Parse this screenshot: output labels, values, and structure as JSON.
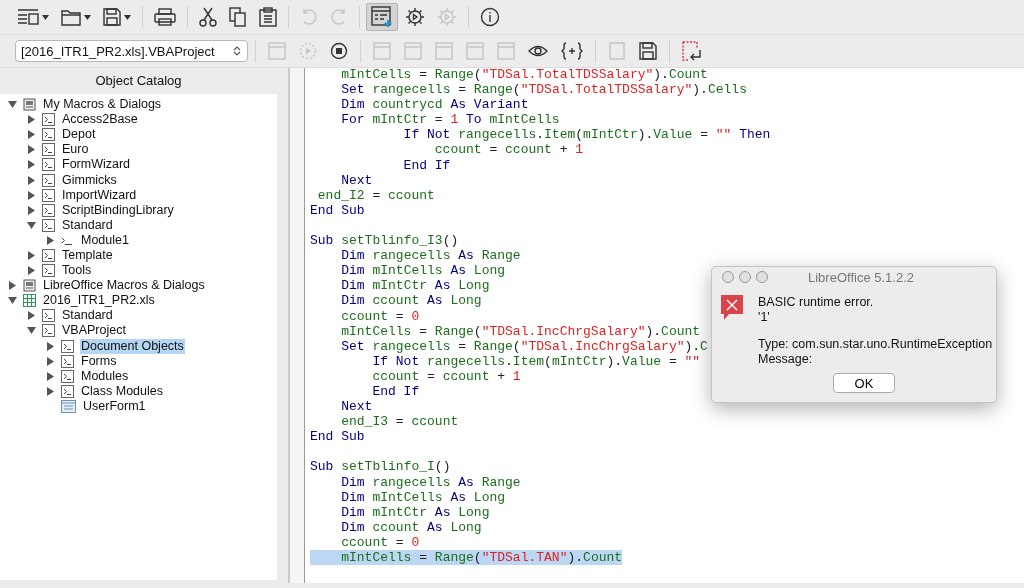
{
  "toolbar": [
    {
      "kind": "list",
      "dropdown": true,
      "disabled": false,
      "pressed": false
    },
    {
      "kind": "folder",
      "dropdown": true,
      "disabled": false,
      "pressed": false
    },
    {
      "kind": "save",
      "dropdown": true,
      "disabled": false,
      "pressed": false
    },
    {
      "kind": "separator"
    },
    {
      "kind": "printer",
      "dropdown": false,
      "disabled": false,
      "pressed": false
    },
    {
      "kind": "separator"
    },
    {
      "kind": "scissors",
      "dropdown": false,
      "disabled": false,
      "pressed": false
    },
    {
      "kind": "copy",
      "dropdown": false,
      "disabled": false,
      "pressed": false
    },
    {
      "kind": "clipboard",
      "dropdown": false,
      "disabled": false,
      "pressed": false
    },
    {
      "kind": "separator"
    },
    {
      "kind": "undo",
      "dropdown": false,
      "disabled": true,
      "pressed": false
    },
    {
      "kind": "redo",
      "dropdown": false,
      "disabled": true,
      "pressed": false
    },
    {
      "kind": "separator"
    },
    {
      "kind": "dialog",
      "dropdown": false,
      "disabled": false,
      "pressed": true
    },
    {
      "kind": "gear",
      "dropdown": false,
      "disabled": false,
      "pressed": false
    },
    {
      "kind": "gear",
      "dropdown": false,
      "disabled": true,
      "pressed": false
    },
    {
      "kind": "separator"
    },
    {
      "kind": "info",
      "dropdown": false,
      "disabled": false,
      "pressed": false
    }
  ],
  "library_select": {
    "value": "[2016_ITR1_PR2.xls].VBAProject"
  },
  "toolbar_2": [
    {
      "kind": "separator"
    },
    {
      "kind": "window",
      "disabled": true
    },
    {
      "kind": "run",
      "disabled": true
    },
    {
      "kind": "stop",
      "disabled": false
    },
    {
      "kind": "separator"
    },
    {
      "kind": "window",
      "disabled": true
    },
    {
      "kind": "window",
      "disabled": true
    },
    {
      "kind": "window",
      "disabled": true
    },
    {
      "kind": "window",
      "disabled": true
    },
    {
      "kind": "window",
      "disabled": true
    },
    {
      "kind": "eye",
      "disabled": false
    },
    {
      "kind": "braces",
      "disabled": false
    },
    {
      "kind": "separator"
    },
    {
      "kind": "page",
      "disabled": true
    },
    {
      "kind": "save",
      "disabled": false
    },
    {
      "kind": "separator"
    },
    {
      "kind": "import",
      "disabled": false
    }
  ],
  "object_catalog": {
    "title": "Object Catalog",
    "tree": [
      {
        "label": "My Macros & Dialogs",
        "kind": "container",
        "expandable": true,
        "expanded": true,
        "selected": false,
        "children": [
          {
            "label": "Access2Base",
            "kind": "library",
            "expandable": true,
            "expanded": false,
            "selected": false
          },
          {
            "label": "Depot",
            "kind": "library",
            "expandable": true,
            "expanded": false,
            "selected": false
          },
          {
            "label": "Euro",
            "kind": "library",
            "expandable": true,
            "expanded": false,
            "selected": false
          },
          {
            "label": "FormWizard",
            "kind": "library",
            "expandable": true,
            "expanded": false,
            "selected": false
          },
          {
            "label": "Gimmicks",
            "kind": "library",
            "expandable": true,
            "expanded": false,
            "selected": false
          },
          {
            "label": "ImportWizard",
            "kind": "library",
            "expandable": true,
            "expanded": false,
            "selected": false
          },
          {
            "label": "ScriptBindingLibrary",
            "kind": "library",
            "expandable": true,
            "expanded": false,
            "selected": false
          },
          {
            "label": "Standard",
            "kind": "library",
            "expandable": true,
            "expanded": true,
            "selected": false,
            "children": [
              {
                "label": "Module1",
                "kind": "module",
                "expandable": true,
                "expanded": false,
                "selected": false
              }
            ]
          },
          {
            "label": "Template",
            "kind": "library",
            "expandable": true,
            "expanded": false,
            "selected": false
          },
          {
            "label": "Tools",
            "kind": "library",
            "expandable": true,
            "expanded": false,
            "selected": false
          }
        ]
      },
      {
        "label": "LibreOffice Macros & Dialogs",
        "kind": "container",
        "expandable": true,
        "expanded": false,
        "selected": false
      },
      {
        "label": "2016_ITR1_PR2.xls",
        "kind": "spreadsheet",
        "expandable": true,
        "expanded": true,
        "selected": false,
        "children": [
          {
            "label": "Standard",
            "kind": "library",
            "expandable": true,
            "expanded": false,
            "selected": false
          },
          {
            "label": "VBAProject",
            "kind": "library",
            "expandable": true,
            "expanded": true,
            "selected": false,
            "children": [
              {
                "label": "Document Objects",
                "kind": "library",
                "expandable": true,
                "expanded": false,
                "selected": true
              },
              {
                "label": "Forms",
                "kind": "library",
                "expandable": true,
                "expanded": false,
                "selected": false
              },
              {
                "label": "Modules",
                "kind": "library",
                "expandable": true,
                "expanded": false,
                "selected": false
              },
              {
                "label": "Class Modules",
                "kind": "library",
                "expandable": true,
                "expanded": false,
                "selected": false
              },
              {
                "label": "UserForm1",
                "kind": "dialog",
                "expandable": false,
                "expanded": false,
                "selected": false
              }
            ]
          }
        ]
      }
    ]
  },
  "code_lines": [
    {
      "kind": "code",
      "selected": false,
      "tokens": [
        {
          "kind": "name",
          "text": "    mIntCells"
        },
        {
          "kind": "punct",
          "text": " = "
        },
        {
          "kind": "name",
          "text": "Range"
        },
        {
          "kind": "punct",
          "text": "("
        },
        {
          "kind": "string",
          "text": "\"TDSal.TotalTDSSalary\""
        },
        {
          "kind": "punct",
          "text": ")."
        },
        {
          "kind": "name",
          "text": "Count"
        }
      ]
    },
    {
      "kind": "code",
      "selected": false,
      "tokens": [
        {
          "kind": "keyword",
          "text": "    Set "
        },
        {
          "kind": "name",
          "text": "rangecells"
        },
        {
          "kind": "punct",
          "text": " = "
        },
        {
          "kind": "name",
          "text": "Range"
        },
        {
          "kind": "punct",
          "text": "("
        },
        {
          "kind": "string",
          "text": "\"TDSal.TotalTDSSalary\""
        },
        {
          "kind": "punct",
          "text": ")."
        },
        {
          "kind": "name",
          "text": "Cells"
        }
      ]
    },
    {
      "kind": "code",
      "selected": false,
      "tokens": [
        {
          "kind": "keyword",
          "text": "    Dim "
        },
        {
          "kind": "name",
          "text": "countrycd "
        },
        {
          "kind": "keyword",
          "text": "As Variant"
        }
      ]
    },
    {
      "kind": "code",
      "selected": false,
      "tokens": [
        {
          "kind": "keyword",
          "text": "    For "
        },
        {
          "kind": "name",
          "text": "mIntCtr"
        },
        {
          "kind": "punct",
          "text": " = "
        },
        {
          "kind": "number",
          "text": "1 "
        },
        {
          "kind": "keyword",
          "text": "To "
        },
        {
          "kind": "name",
          "text": "mIntCells"
        }
      ]
    },
    {
      "kind": "code",
      "selected": false,
      "tokens": [
        {
          "kind": "keyword",
          "text": "            If Not "
        },
        {
          "kind": "name",
          "text": "rangecells"
        },
        {
          "kind": "punct",
          "text": "."
        },
        {
          "kind": "name",
          "text": "Item"
        },
        {
          "kind": "punct",
          "text": "("
        },
        {
          "kind": "name",
          "text": "mIntCtr"
        },
        {
          "kind": "punct",
          "text": ")."
        },
        {
          "kind": "name",
          "text": "Value"
        },
        {
          "kind": "punct",
          "text": " = "
        },
        {
          "kind": "string",
          "text": "\"\" "
        },
        {
          "kind": "keyword",
          "text": "Then"
        }
      ]
    },
    {
      "kind": "code",
      "selected": false,
      "tokens": [
        {
          "kind": "name",
          "text": "                ccount"
        },
        {
          "kind": "punct",
          "text": " = "
        },
        {
          "kind": "name",
          "text": "ccount"
        },
        {
          "kind": "punct",
          "text": " + "
        },
        {
          "kind": "number",
          "text": "1"
        }
      ]
    },
    {
      "kind": "code",
      "selected": false,
      "tokens": [
        {
          "kind": "keyword",
          "text": "            End If"
        }
      ]
    },
    {
      "kind": "code",
      "selected": false,
      "tokens": [
        {
          "kind": "keyword",
          "text": "    Next"
        }
      ]
    },
    {
      "kind": "code",
      "selected": false,
      "tokens": [
        {
          "kind": "name",
          "text": " end_I2"
        },
        {
          "kind": "punct",
          "text": " = "
        },
        {
          "kind": "name",
          "text": "ccount"
        }
      ]
    },
    {
      "kind": "code",
      "selected": false,
      "tokens": [
        {
          "kind": "keyword",
          "text": "End Sub"
        }
      ]
    },
    {
      "kind": "blank",
      "selected": false
    },
    {
      "kind": "code",
      "selected": false,
      "tokens": [
        {
          "kind": "keyword",
          "text": "Sub "
        },
        {
          "kind": "name",
          "text": "setTblinfo_I3"
        },
        {
          "kind": "punct",
          "text": "()"
        }
      ]
    },
    {
      "kind": "code",
      "selected": false,
      "tokens": [
        {
          "kind": "keyword",
          "text": "    Dim "
        },
        {
          "kind": "name",
          "text": "rangecells "
        },
        {
          "kind": "keyword",
          "text": "As "
        },
        {
          "kind": "name",
          "text": "Range"
        }
      ]
    },
    {
      "kind": "code",
      "selected": false,
      "tokens": [
        {
          "kind": "keyword",
          "text": "    Dim "
        },
        {
          "kind": "name",
          "text": "mIntCells "
        },
        {
          "kind": "keyword",
          "text": "As "
        },
        {
          "kind": "name",
          "text": "Long"
        }
      ]
    },
    {
      "kind": "code",
      "selected": false,
      "tokens": [
        {
          "kind": "keyword",
          "text": "    Dim "
        },
        {
          "kind": "name",
          "text": "mIntCtr "
        },
        {
          "kind": "keyword",
          "text": "As "
        },
        {
          "kind": "name",
          "text": "Long"
        }
      ]
    },
    {
      "kind": "code",
      "selected": false,
      "tokens": [
        {
          "kind": "keyword",
          "text": "    Dim "
        },
        {
          "kind": "name",
          "text": "ccount "
        },
        {
          "kind": "keyword",
          "text": "As "
        },
        {
          "kind": "name",
          "text": "Long"
        }
      ]
    },
    {
      "kind": "code",
      "selected": false,
      "tokens": [
        {
          "kind": "name",
          "text": "    ccount"
        },
        {
          "kind": "punct",
          "text": " = "
        },
        {
          "kind": "number",
          "text": "0"
        }
      ]
    },
    {
      "kind": "code",
      "selected": false,
      "tokens": [
        {
          "kind": "name",
          "text": "    mIntCells"
        },
        {
          "kind": "punct",
          "text": " = "
        },
        {
          "kind": "name",
          "text": "Range"
        },
        {
          "kind": "punct",
          "text": "("
        },
        {
          "kind": "string",
          "text": "\"TDSal.IncChrgSalary\""
        },
        {
          "kind": "punct",
          "text": ")."
        },
        {
          "kind": "name",
          "text": "Count"
        }
      ]
    },
    {
      "kind": "code",
      "selected": false,
      "tokens": [
        {
          "kind": "keyword",
          "text": "    Set "
        },
        {
          "kind": "name",
          "text": "rangecells"
        },
        {
          "kind": "punct",
          "text": " = "
        },
        {
          "kind": "name",
          "text": "Range"
        },
        {
          "kind": "punct",
          "text": "("
        },
        {
          "kind": "string",
          "text": "\"TDSal.IncChrgSalary\""
        },
        {
          "kind": "punct",
          "text": ")."
        },
        {
          "kind": "name",
          "text": "C"
        }
      ]
    },
    {
      "kind": "code",
      "selected": false,
      "tokens": [
        {
          "kind": "keyword",
          "text": "        If Not "
        },
        {
          "kind": "name",
          "text": "rangecells"
        },
        {
          "kind": "punct",
          "text": "."
        },
        {
          "kind": "name",
          "text": "Item"
        },
        {
          "kind": "punct",
          "text": "("
        },
        {
          "kind": "name",
          "text": "mIntCtr"
        },
        {
          "kind": "punct",
          "text": ")."
        },
        {
          "kind": "name",
          "text": "Value"
        },
        {
          "kind": "punct",
          "text": " = "
        },
        {
          "kind": "string",
          "text": "\"\""
        }
      ]
    },
    {
      "kind": "code",
      "selected": false,
      "tokens": [
        {
          "kind": "name",
          "text": "        ccount"
        },
        {
          "kind": "punct",
          "text": " = "
        },
        {
          "kind": "name",
          "text": "ccount"
        },
        {
          "kind": "punct",
          "text": " + "
        },
        {
          "kind": "number",
          "text": "1"
        }
      ]
    },
    {
      "kind": "code",
      "selected": false,
      "tokens": [
        {
          "kind": "keyword",
          "text": "        End If"
        }
      ]
    },
    {
      "kind": "code",
      "selected": false,
      "tokens": [
        {
          "kind": "keyword",
          "text": "    Next"
        }
      ]
    },
    {
      "kind": "code",
      "selected": false,
      "tokens": [
        {
          "kind": "name",
          "text": "    end_I3"
        },
        {
          "kind": "punct",
          "text": " = "
        },
        {
          "kind": "name",
          "text": "ccount"
        }
      ]
    },
    {
      "kind": "code",
      "selected": false,
      "tokens": [
        {
          "kind": "keyword",
          "text": "End Sub"
        }
      ]
    },
    {
      "kind": "blank",
      "selected": false
    },
    {
      "kind": "code",
      "selected": false,
      "tokens": [
        {
          "kind": "keyword",
          "text": "Sub "
        },
        {
          "kind": "name",
          "text": "setTblinfo_I"
        },
        {
          "kind": "punct",
          "text": "()"
        }
      ]
    },
    {
      "kind": "code",
      "selected": false,
      "tokens": [
        {
          "kind": "keyword",
          "text": "    Dim "
        },
        {
          "kind": "name",
          "text": "rangecells "
        },
        {
          "kind": "keyword",
          "text": "As "
        },
        {
          "kind": "name",
          "text": "Range"
        }
      ]
    },
    {
      "kind": "code",
      "selected": false,
      "tokens": [
        {
          "kind": "keyword",
          "text": "    Dim "
        },
        {
          "kind": "name",
          "text": "mIntCells "
        },
        {
          "kind": "keyword",
          "text": "As "
        },
        {
          "kind": "name",
          "text": "Long"
        }
      ]
    },
    {
      "kind": "code",
      "selected": false,
      "tokens": [
        {
          "kind": "keyword",
          "text": "    Dim "
        },
        {
          "kind": "name",
          "text": "mIntCtr "
        },
        {
          "kind": "keyword",
          "text": "As "
        },
        {
          "kind": "name",
          "text": "Long"
        }
      ]
    },
    {
      "kind": "code",
      "selected": false,
      "tokens": [
        {
          "kind": "keyword",
          "text": "    Dim "
        },
        {
          "kind": "name",
          "text": "ccount "
        },
        {
          "kind": "keyword",
          "text": "As "
        },
        {
          "kind": "name",
          "text": "Long"
        }
      ]
    },
    {
      "kind": "code",
      "selected": false,
      "tokens": [
        {
          "kind": "name",
          "text": "    ccount"
        },
        {
          "kind": "punct",
          "text": " = "
        },
        {
          "kind": "number",
          "text": "0"
        }
      ]
    },
    {
      "kind": "code",
      "selected": true,
      "tokens": [
        {
          "kind": "name",
          "text": "    mIntCells"
        },
        {
          "kind": "punct",
          "text": " = "
        },
        {
          "kind": "name",
          "text": "Range"
        },
        {
          "kind": "punct",
          "text": "("
        },
        {
          "kind": "string",
          "text": "\"TDSal.TAN\""
        },
        {
          "kind": "punct",
          "text": ")."
        },
        {
          "kind": "name",
          "text": "Count"
        }
      ]
    }
  ],
  "error_dialog": {
    "title": "LibreOffice 5.1.2.2",
    "heading": "BASIC runtime error.",
    "code": "'1'",
    "type_line": "Type: com.sun.star.uno.RuntimeException",
    "message_label": "Message:",
    "button": "OK"
  }
}
